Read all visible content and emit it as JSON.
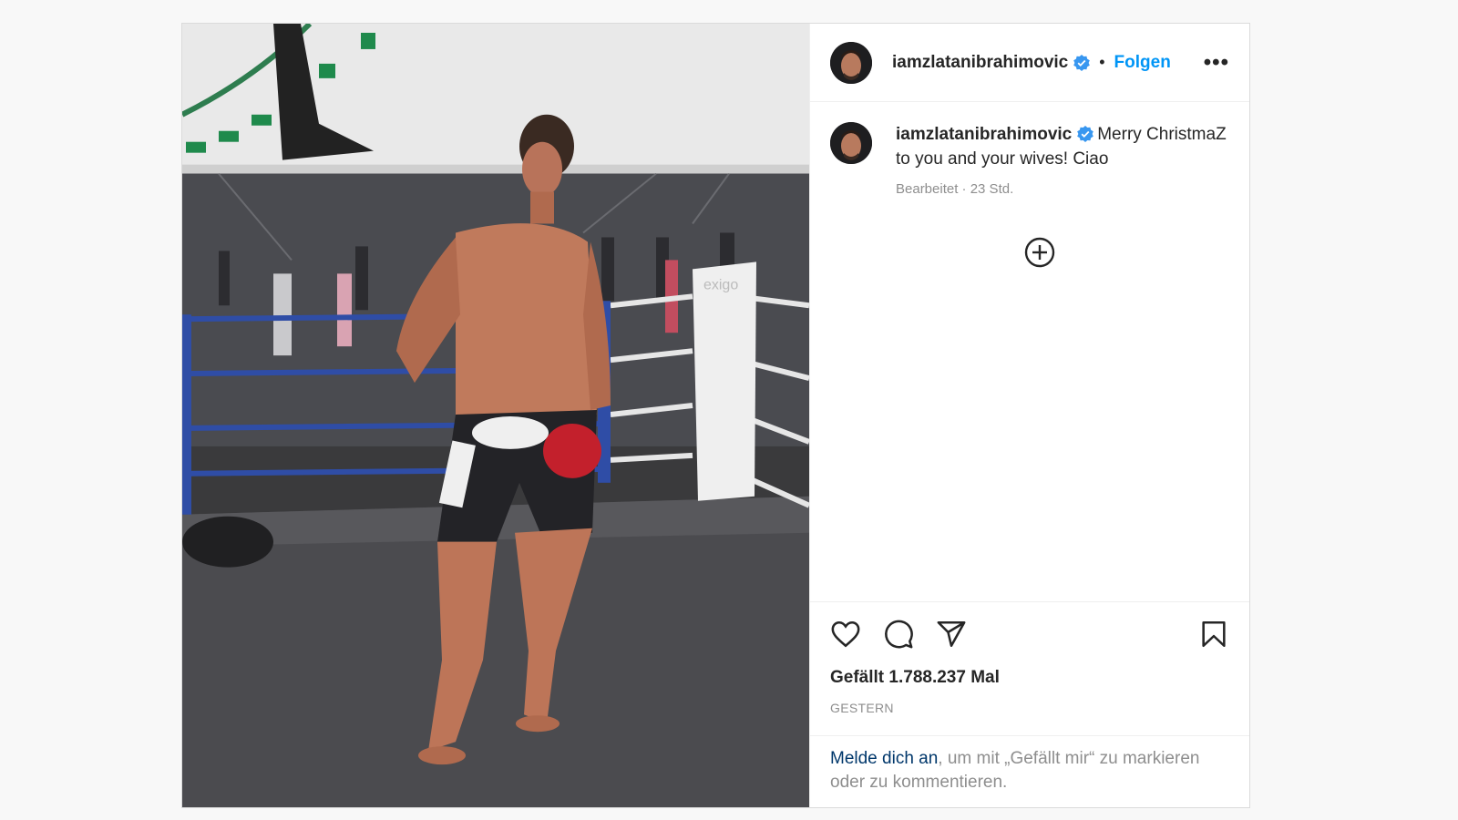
{
  "post": {
    "username": "iamzlatanibrahimovic",
    "separator": "•",
    "follow_label": "Folgen",
    "more_label": "•••",
    "caption_text": "Merry ChristmaZ to you and your wives! Ciao",
    "caption_meta": "Bearbeitet · 23 Std.",
    "likes_text": "Gefällt 1.788.237 Mal",
    "date_text": "GESTERN",
    "login_link": "Melde dich an",
    "login_rest": ", um mit „Gefällt mir“ zu markieren oder zu kommentieren."
  },
  "icons": {
    "verified": "verified-badge-icon",
    "add_comment": "plus-circle-icon",
    "like": "heart-icon",
    "comment": "comment-bubble-icon",
    "share": "paper-plane-icon",
    "save": "bookmark-icon"
  },
  "colors": {
    "accent": "#0095f6",
    "link": "#00376b",
    "muted": "#8e8e8e"
  }
}
